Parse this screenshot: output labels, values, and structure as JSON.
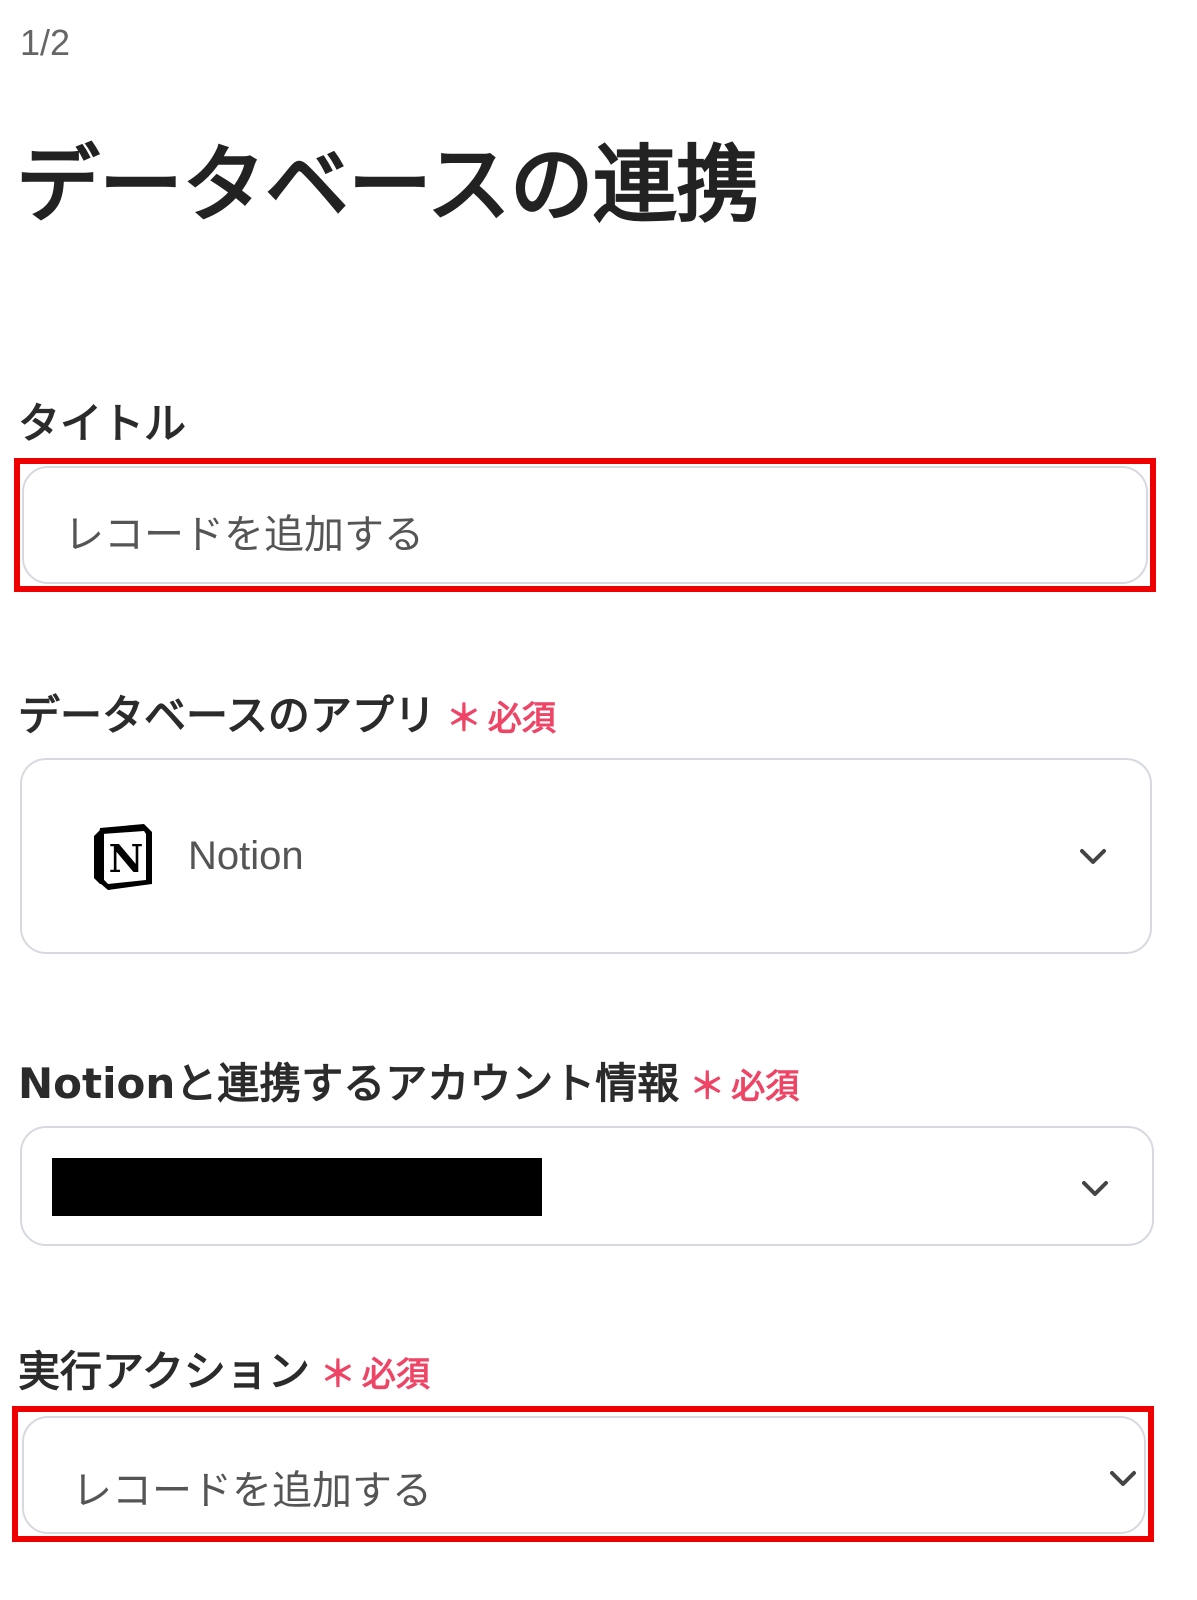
{
  "header": {
    "step": "1/2",
    "title": "データベースの連携"
  },
  "fields": {
    "title_field": {
      "label": "タイトル",
      "value": "レコードを追加する"
    },
    "database_app": {
      "label": "データベースのアプリ",
      "required_mark": "＊",
      "required_text": "必須",
      "selected": "Notion",
      "icon": "notion-logo-icon"
    },
    "account": {
      "label": "Notionと連携するアカウント情報",
      "required_mark": "＊",
      "required_text": "必須"
    },
    "action": {
      "label": "実行アクション",
      "required_mark": "＊",
      "required_text": "必須",
      "selected": "レコードを追加する"
    }
  },
  "colors": {
    "highlight": "#ee0000",
    "required": "#ee4466",
    "border": "#d6d9df"
  }
}
